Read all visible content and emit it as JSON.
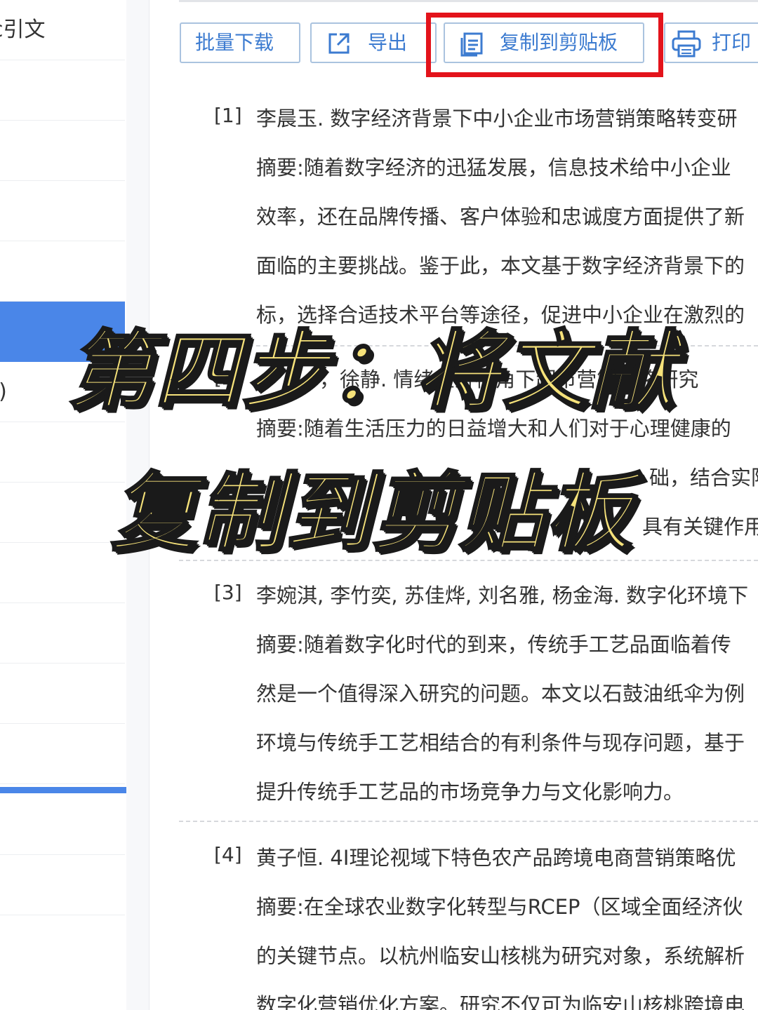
{
  "sidebar": {
    "items": [
      {
        "label": "c引文"
      },
      {
        "label": ")"
      },
      {
        "label": ""
      },
      {
        "label": ""
      },
      {
        "label": ""
      },
      {
        "label": ""
      },
      {
        "label": ":)"
      },
      {
        "label": ""
      },
      {
        "label": ""
      },
      {
        "label": ""
      },
      {
        "label": ""
      },
      {
        "label": ""
      },
      {
        "label": ""
      },
      {
        "label": ""
      },
      {
        "label": ""
      }
    ]
  },
  "toolbar": {
    "batch_download": "批量下载",
    "export": "导出",
    "copy_clipboard": "复制到剪贴板",
    "print": "打印"
  },
  "references": [
    {
      "num": "[1]",
      "lines": [
        "李晨玉. 数字经济背景下中小企业市场营销策略转变研",
        "摘要:随着数字经济的迅猛发展，信息技术给中小企业",
        "效率，还在品牌传播、客户体验和忠诚度方面提供了新",
        "面临的主要挑战。鉴于此，本文基于数字经济背景下的",
        "标，选择合适技术平台等途径，促进中小企业在激烈的"
      ]
    },
    {
      "num": "[2]",
      "lines": [
        "，徐静. 情绪经济视角下超市营销策略研究",
        "摘要:随着生活压力的日益增大和人们对于心理健康的",
        "础，结合实际",
        "具有关键作用。"
      ]
    },
    {
      "num": "[3]",
      "lines": [
        "李婉淇, 李竹奕, 苏佳烨, 刘名雅, 杨金海. 数字化环境下",
        "摘要:随着数字化时代的到来，传统手工艺品面临着传",
        "然是一个值得深入研究的问题。本文以石鼓油纸伞为例",
        "环境与传统手工艺相结合的有利条件与现存问题，基于",
        "提升传统手工艺品的市场竞争力与文化影响力。"
      ]
    },
    {
      "num": "[4]",
      "lines": [
        "黄子恒. 4I理论视域下特色农产品跨境电商营销策略优",
        "摘要:在全球农业数字化转型与RCEP（区域全面经济伙",
        "的关键节点。以杭州临安山核桃为研究对象，系统解析",
        "数字化营销优化方案。研究不仅可为临安山核桃跨境电"
      ]
    }
  ],
  "overlay": {
    "line1": "第四步：将文献",
    "line2": "复制到剪贴板"
  },
  "colors": {
    "accent": "#3c7bd0",
    "highlight": "#e3131b",
    "sidebar_active": "#4a86e8",
    "caption_fill": "#f6e27a"
  }
}
